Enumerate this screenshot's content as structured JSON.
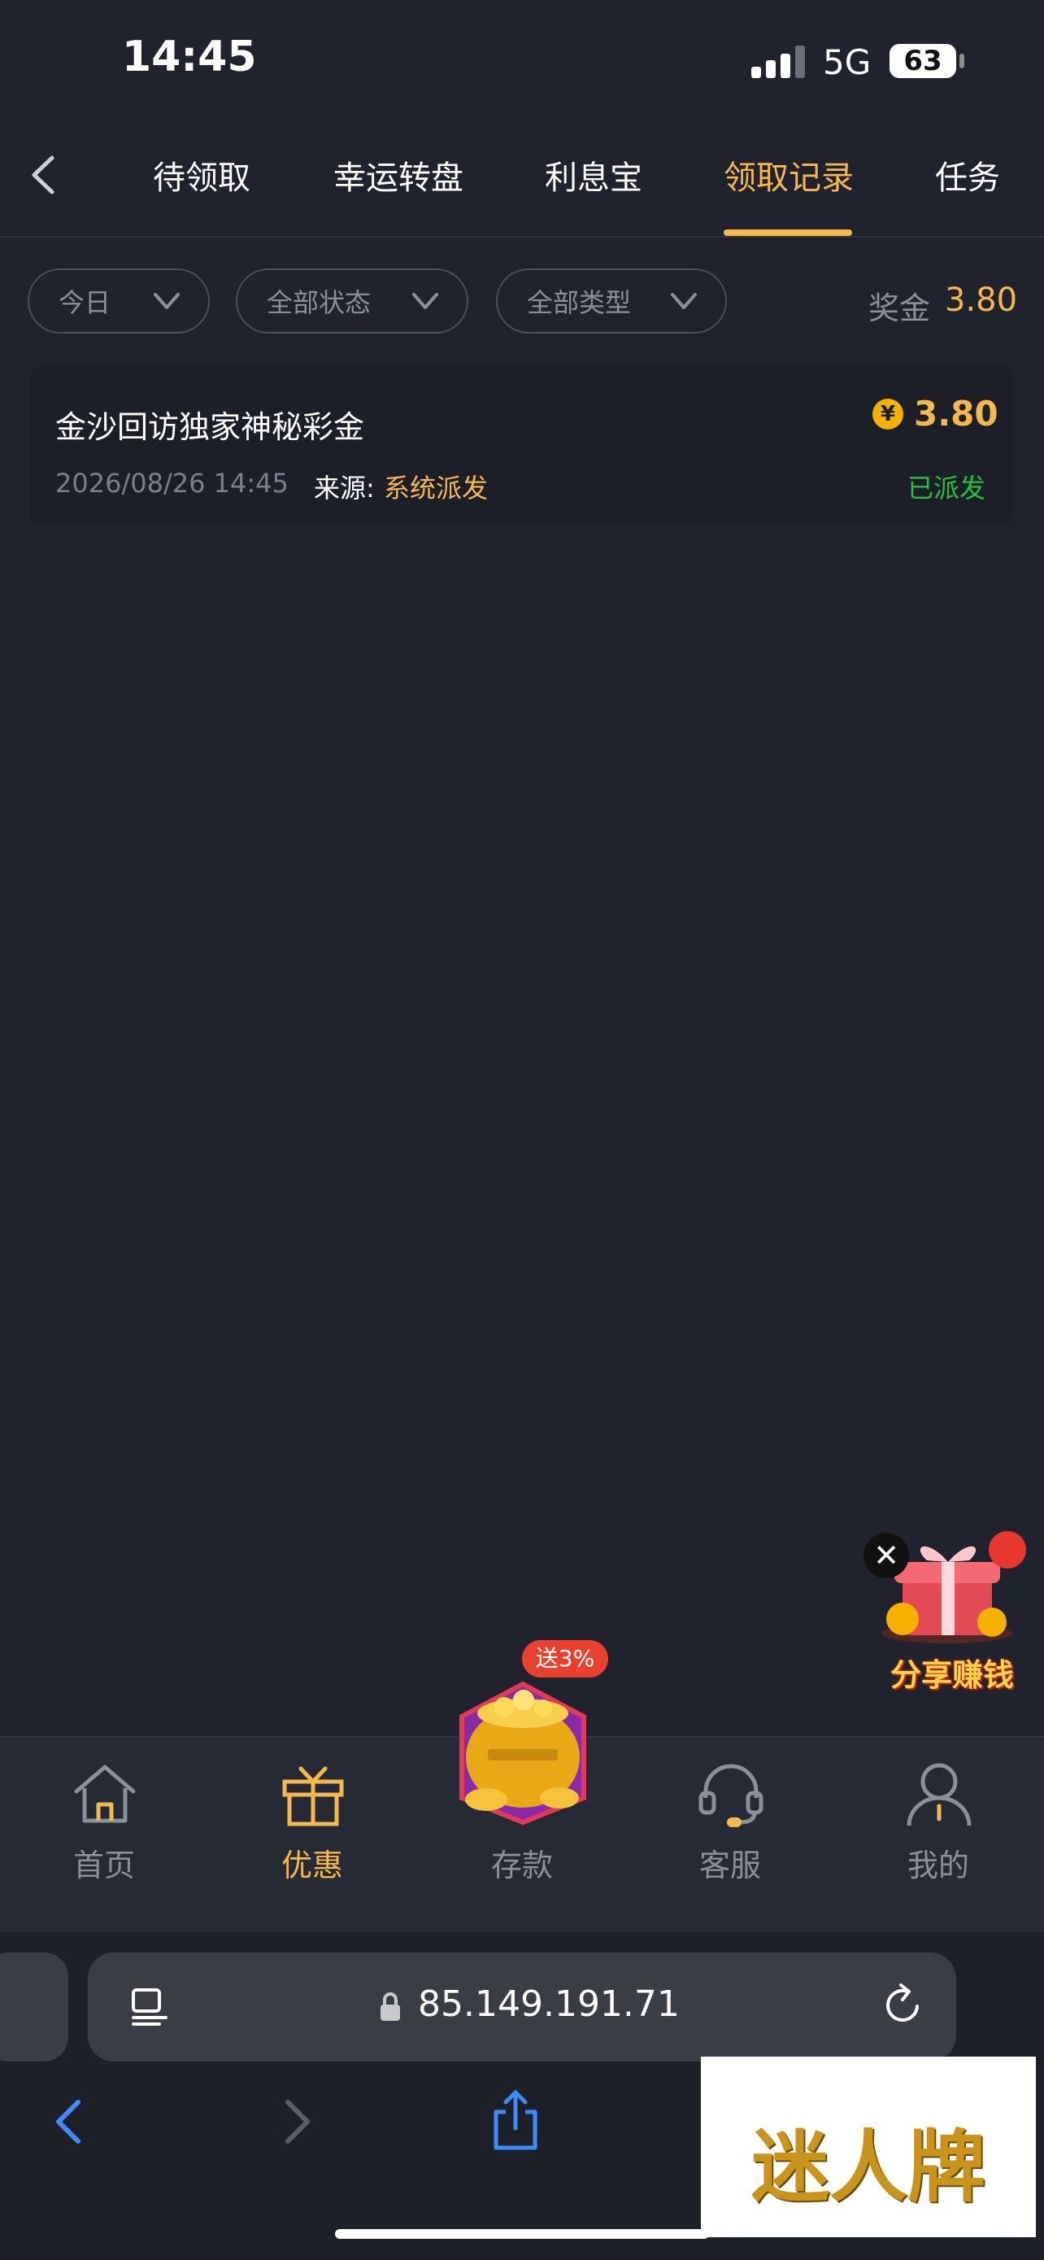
{
  "status_bar": {
    "time": "14:45",
    "network": "5G",
    "battery": "63"
  },
  "top_nav": {
    "tabs": [
      {
        "label": "待领取",
        "active": false
      },
      {
        "label": "幸运转盘",
        "active": false
      },
      {
        "label": "利息宝",
        "active": false
      },
      {
        "label": "领取记录",
        "active": true
      },
      {
        "label": "任务",
        "active": false
      }
    ]
  },
  "filters": {
    "date": "今日",
    "status": "全部状态",
    "type": "全部类型"
  },
  "bonus_summary": {
    "label": "奖金",
    "value": "3.80"
  },
  "records": [
    {
      "title": "金沙回访独家神秘彩金",
      "currency_symbol": "¥",
      "amount": "3.80",
      "date": "2026/08/26 14:45",
      "source_label": "来源:",
      "source": "系统派发",
      "status": "已派发"
    }
  ],
  "floating_widget": {
    "close": "✕",
    "label": "分享赚钱"
  },
  "tab_bar": {
    "items": [
      {
        "label": "首页",
        "icon": "home-icon",
        "active": false
      },
      {
        "label": "优惠",
        "icon": "gift-icon",
        "active": true
      },
      {
        "label": "存款",
        "icon": "treasure-pot-icon",
        "active": false
      },
      {
        "label": "客服",
        "icon": "headset-icon",
        "active": false
      },
      {
        "label": "我的",
        "icon": "profile-icon",
        "active": false
      }
    ],
    "promo_badge": "送3%"
  },
  "browser": {
    "url": "85.149.191.71"
  },
  "watermark": "迷人牌",
  "colors": {
    "accent": "#f5b84d",
    "success": "#27c13e",
    "background": "#20232d",
    "card": "#1c1f28"
  }
}
